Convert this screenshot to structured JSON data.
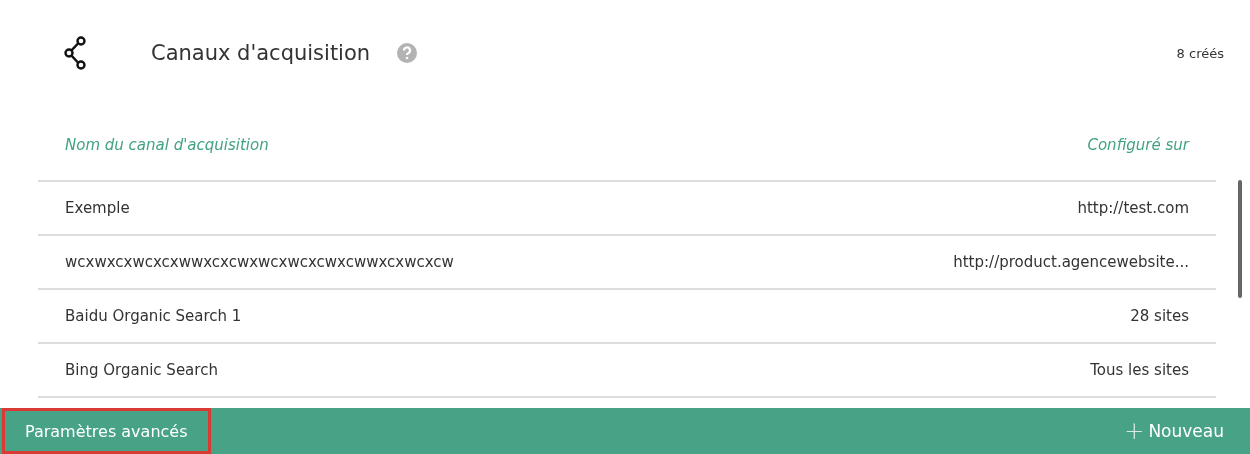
{
  "header": {
    "title": "Canaux d'acquisition",
    "count": "8 créés"
  },
  "table": {
    "columns": [
      "Nom du canal d'acquisition",
      "Configuré sur"
    ],
    "rows": [
      {
        "name": "Exemple",
        "target": "http://test.com"
      },
      {
        "name": "wcxwxcxwcxcxwwxcxcwxwcxwcxcwxcwwxcxwcxcw",
        "target": "http://product.agencewebsite..."
      },
      {
        "name": "Baidu Organic Search 1",
        "target": "28 sites"
      },
      {
        "name": "Bing Organic Search",
        "target": "Tous les sites"
      }
    ]
  },
  "footer": {
    "advanced": "Paramètres avancés",
    "new_icon": "+",
    "new": "Nouveau"
  }
}
